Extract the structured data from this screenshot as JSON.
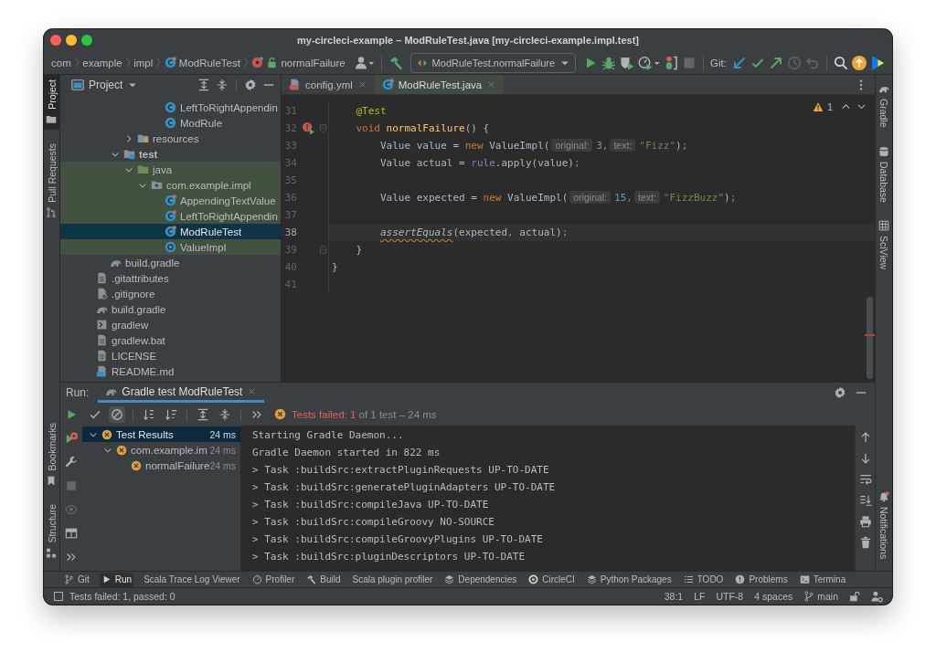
{
  "window": {
    "title": "my-circleci-example – ModRuleTest.java [my-circleci-example.impl.test]"
  },
  "breadcrumbs": [
    {
      "label": "com",
      "kind": "package"
    },
    {
      "label": "example",
      "kind": "package"
    },
    {
      "label": "impl",
      "kind": "package"
    },
    {
      "label": "ModRuleTest",
      "kind": "test-class"
    },
    {
      "label": "normalFailure",
      "kind": "method"
    }
  ],
  "toolbar": [
    [
      {
        "kind": "account",
        "disabled": false
      }
    ],
    [
      {
        "kind": "build",
        "disabled": false
      },
      {
        "kind": "run-config",
        "label": "ModRuleTest.normalFailure"
      },
      {
        "kind": "run",
        "disabled": false
      },
      {
        "kind": "debug",
        "disabled": false
      },
      {
        "kind": "coverage",
        "disabled": false
      },
      {
        "kind": "profile",
        "disabled": false
      },
      {
        "kind": "attach",
        "disabled": false
      },
      {
        "kind": "stop",
        "disabled": true
      }
    ],
    [
      {
        "kind": "label",
        "label": "Git:"
      },
      {
        "kind": "update",
        "disabled": false
      },
      {
        "kind": "commit",
        "disabled": false
      },
      {
        "kind": "push",
        "disabled": false
      },
      {
        "kind": "history",
        "disabled": true
      },
      {
        "kind": "rollback",
        "disabled": true
      }
    ],
    [
      {
        "kind": "search",
        "disabled": false
      },
      {
        "kind": "ide-update",
        "disabled": false
      },
      {
        "kind": "toolbox",
        "disabled": false
      }
    ]
  ],
  "left_stripe": {
    "top": [
      {
        "label": "Project",
        "kind": "project",
        "selected": true
      },
      {
        "label": "Pull Requests",
        "kind": "pull-requests",
        "selected": false
      }
    ],
    "bottom": [
      {
        "label": "Bookmarks",
        "kind": "bookmarks",
        "selected": false
      },
      {
        "label": "Structure",
        "kind": "structure",
        "selected": false
      }
    ]
  },
  "right_stripe": {
    "top": [
      {
        "label": "Gradle",
        "kind": "gradle",
        "selected": false
      },
      {
        "label": "Database",
        "kind": "database",
        "selected": false
      },
      {
        "label": "SciView",
        "kind": "sciview",
        "selected": false
      }
    ],
    "bottom": [
      {
        "label": "Notifications",
        "kind": "notifications",
        "selected": false
      }
    ]
  },
  "project_panel": {
    "title": "Project",
    "tree": [
      {
        "children": [
          {
            "children": [
              {
                "children": [
                  {
                    "children": [
                      {
                        "children": [
                          {
                            "label": "LeftToRightAppendin",
                            "kind": "class",
                            "selected": false,
                            "highlighted": false,
                            "bold": false
                          },
                          {
                            "label": "ModRule",
                            "kind": "class",
                            "selected": false,
                            "highlighted": false,
                            "bold": false
                          }
                        ]
                      }
                    ]
                  },
                  {
                    "label": "resources",
                    "kind": "resources-folder",
                    "expanded": false,
                    "selected": false,
                    "highlighted": false,
                    "bold": false
                  }
                ]
              },
              {
                "label": "test",
                "kind": "test-folder",
                "expanded": true,
                "selected": false,
                "highlighted": false,
                "bold": true,
                "children": [
                  {
                    "label": "java",
                    "kind": "source-folder",
                    "expanded": true,
                    "selected": false,
                    "highlighted": true,
                    "bold": false,
                    "children": [
                      {
                        "label": "com.example.impl",
                        "kind": "package",
                        "expanded": true,
                        "selected": false,
                        "highlighted": true,
                        "bold": false,
                        "children": [
                          {
                            "label": "AppendingTextValue",
                            "kind": "test-class",
                            "selected": false,
                            "highlighted": true,
                            "bold": false
                          },
                          {
                            "label": "LeftToRightAppendin",
                            "kind": "test-class",
                            "selected": false,
                            "highlighted": true,
                            "bold": false
                          },
                          {
                            "label": "ModRuleTest",
                            "kind": "test-class",
                            "selected": true,
                            "highlighted": true,
                            "bold": false
                          },
                          {
                            "label": "ValueImpl",
                            "kind": "record",
                            "selected": false,
                            "highlighted": true,
                            "bold": false
                          }
                        ]
                      }
                    ]
                  }
                ]
              }
            ]
          },
          {
            "label": "build.gradle",
            "kind": "gradle",
            "selected": false,
            "highlighted": false,
            "bold": false
          }
        ]
      },
      {
        "label": ".gitattributes",
        "kind": "text",
        "selected": false,
        "highlighted": false,
        "bold": false
      },
      {
        "label": ".gitignore",
        "kind": "ignored",
        "selected": false,
        "highlighted": false,
        "bold": false
      },
      {
        "label": "build.gradle",
        "kind": "gradle",
        "selected": false,
        "highlighted": false,
        "bold": false
      },
      {
        "label": "gradlew",
        "kind": "script",
        "selected": false,
        "highlighted": false,
        "bold": false
      },
      {
        "label": "gradlew.bat",
        "kind": "text",
        "selected": false,
        "highlighted": false,
        "bold": false
      },
      {
        "label": "LICENSE",
        "kind": "text",
        "selected": false,
        "highlighted": false,
        "bold": false
      },
      {
        "label": "README.md",
        "kind": "markdown",
        "selected": false,
        "highlighted": false,
        "bold": false
      }
    ]
  },
  "editor": {
    "tabs": [
      {
        "label": "config.yml",
        "kind": "yaml",
        "selected": false
      },
      {
        "label": "ModRuleTest.java",
        "kind": "test-class",
        "selected": true
      }
    ],
    "warning_count": "1",
    "lines": [
      {
        "children": [
          {
            "number": "31",
            "current": false,
            "tokens": [
              {
                "text": "@Test",
                "kind": "annotation"
              }
            ]
          },
          {
            "number": "32",
            "current": false,
            "gutter": {
              "kind": "failed-test"
            },
            "tokens": [
              {
                "text": "void ",
                "kind": "keyword"
              },
              {
                "text": "normalFailure",
                "kind": "method"
              },
              {
                "text": "() {",
                "kind": "plain"
              }
            ],
            "children": [
              {
                "number": "33",
                "current": false,
                "tokens": [
                  {
                    "text": "Value value = ",
                    "kind": "plain"
                  },
                  {
                    "text": "new",
                    "kind": "keyword"
                  },
                  {
                    "text": " ValueImpl(",
                    "kind": "plain"
                  },
                  {
                    "text": "original:",
                    "kind": "hint"
                  },
                  {
                    "text": "3",
                    "kind": "number"
                  },
                  {
                    "text": ",",
                    "kind": "punct"
                  },
                  {
                    "text": "text:",
                    "kind": "hint"
                  },
                  {
                    "text": "\"Fizz\"",
                    "kind": "string"
                  },
                  {
                    "text": ")",
                    "kind": "plain"
                  },
                  {
                    "text": ";",
                    "kind": "punct"
                  }
                ]
              },
              {
                "number": "34",
                "current": false,
                "tokens": [
                  {
                    "text": "Value actual = ",
                    "kind": "plain"
                  },
                  {
                    "text": "rule",
                    "kind": "field"
                  },
                  {
                    "text": ".apply(value)",
                    "kind": "plain"
                  },
                  {
                    "text": ";",
                    "kind": "punct"
                  }
                ]
              },
              {
                "number": "35",
                "current": false
              },
              {
                "number": "36",
                "current": false,
                "tokens": [
                  {
                    "text": "Value expected = ",
                    "kind": "plain"
                  },
                  {
                    "text": "new",
                    "kind": "keyword"
                  },
                  {
                    "text": " ValueImpl(",
                    "kind": "plain"
                  },
                  {
                    "text": "original:",
                    "kind": "hint"
                  },
                  {
                    "text": "15",
                    "kind": "number"
                  },
                  {
                    "text": ",",
                    "kind": "punct"
                  },
                  {
                    "text": "text:",
                    "kind": "hint"
                  },
                  {
                    "text": "\"FizzBuzz\"",
                    "kind": "string"
                  },
                  {
                    "text": ")",
                    "kind": "plain"
                  },
                  {
                    "text": ";",
                    "kind": "punct"
                  }
                ]
              },
              {
                "number": "37",
                "current": false
              },
              {
                "number": "38",
                "current": true,
                "tokens": [
                  {
                    "text": "assertEquals",
                    "kind": "static-warning"
                  },
                  {
                    "text": "(expected",
                    "kind": "plain"
                  },
                  {
                    "text": ",",
                    "kind": "punct"
                  },
                  {
                    "text": " actual)",
                    "kind": "plain"
                  },
                  {
                    "text": ";",
                    "kind": "punct"
                  }
                ]
              }
            ]
          },
          {
            "number": "39",
            "current": false,
            "tokens": [
              {
                "text": "}",
                "kind": "plain"
              }
            ]
          }
        ]
      },
      {
        "number": "40",
        "current": false,
        "tokens": [
          {
            "text": "}",
            "kind": "plain"
          }
        ]
      },
      {
        "number": "41",
        "current": false
      }
    ]
  },
  "run_panel": {
    "title": "Run:",
    "tabs": [
      {
        "label": "Gradle test ModRuleTest",
        "selected": true
      }
    ],
    "side_tools": [
      {
        "kind": "rerun",
        "disabled": false
      },
      {
        "kind": "rerun-failed",
        "disabled": false
      },
      {
        "kind": "settings",
        "disabled": false
      },
      {
        "kind": "stop",
        "disabled": true
      },
      {
        "kind": "show",
        "disabled": true
      },
      {
        "kind": "layout",
        "disabled": false
      },
      {
        "kind": "more",
        "disabled": false
      }
    ],
    "test_tools": [
      [
        {
          "kind": "show-passed",
          "selected": false
        },
        {
          "kind": "show-ignored",
          "selected": true
        }
      ],
      [
        {
          "kind": "sort-alpha",
          "selected": false
        },
        {
          "kind": "sort-duration",
          "selected": false
        }
      ],
      [
        {
          "kind": "expand-all",
          "selected": false
        },
        {
          "kind": "collapse-all",
          "selected": false
        }
      ],
      [
        {
          "kind": "more",
          "selected": false
        }
      ]
    ],
    "status": {
      "failed": true,
      "label": "Tests failed: 1",
      "summary": "of 1 test – 24 ms"
    },
    "test_tree": [
      {
        "label": "Test Results",
        "time": "24 ms",
        "failed": true,
        "selected": true,
        "expanded": true,
        "children": [
          {
            "label": "com.example.im",
            "time": "24 ms",
            "failed": true,
            "selected": false,
            "expanded": true,
            "children": [
              {
                "label": "normalFailure",
                "time": "24 ms",
                "failed": true,
                "selected": false
              }
            ]
          }
        ]
      }
    ],
    "console": [
      "Starting Gradle Daemon...",
      "Gradle Daemon started in 822 ms",
      "> Task :buildSrc:extractPluginRequests UP-TO-DATE",
      "> Task :buildSrc:generatePluginAdapters UP-TO-DATE",
      "> Task :buildSrc:compileJava UP-TO-DATE",
      "> Task :buildSrc:compileGroovy NO-SOURCE",
      "> Task :buildSrc:compileGroovyPlugins UP-TO-DATE",
      "> Task :buildSrc:pluginDescriptors UP-TO-DATE"
    ]
  },
  "tool_windows": [
    {
      "label": "Git",
      "kind": "git",
      "selected": false
    },
    {
      "label": "Run",
      "kind": "run",
      "selected": true
    },
    {
      "label": "Scala Trace Log Viewer",
      "kind": "scala-trace",
      "selected": false
    },
    {
      "label": "Profiler",
      "kind": "profiler",
      "selected": false
    },
    {
      "label": "Build",
      "kind": "build",
      "selected": false
    },
    {
      "label": "Scala plugin profiler",
      "kind": "scala-profiler",
      "selected": false
    },
    {
      "label": "Dependencies",
      "kind": "dependencies",
      "selected": false
    },
    {
      "label": "CircleCI",
      "kind": "circleci",
      "selected": false
    },
    {
      "label": "Python Packages",
      "kind": "python-packages",
      "selected": false
    },
    {
      "label": "TODO",
      "kind": "todo",
      "selected": false
    },
    {
      "label": "Problems",
      "kind": "problems",
      "selected": false
    },
    {
      "label": "Termina",
      "kind": "terminal",
      "selected": false
    }
  ],
  "status_bar": {
    "message": "Tests failed: 1, passed: 0",
    "position": "38:1",
    "line_separator": "LF",
    "encoding": "UTF-8",
    "indent": "4 spaces",
    "branch": "main"
  }
}
